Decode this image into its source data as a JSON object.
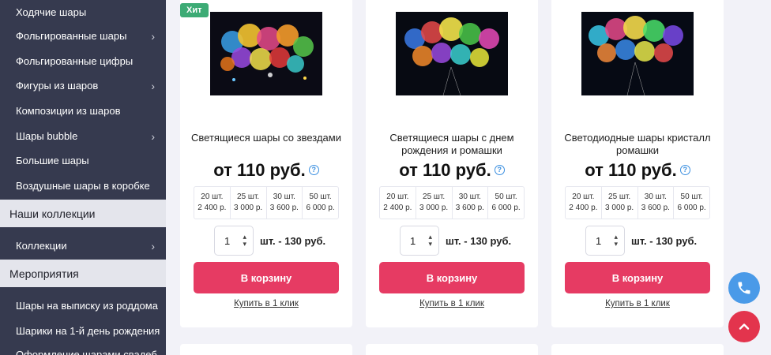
{
  "sidebar": {
    "items": [
      {
        "label": "Ходячие шары",
        "arrow": false
      },
      {
        "label": "Фольгированные шары",
        "arrow": true
      },
      {
        "label": "Фольгированные цифры",
        "arrow": false
      },
      {
        "label": "Фигуры из шаров",
        "arrow": true
      },
      {
        "label": "Композиции из шаров",
        "arrow": false
      },
      {
        "label": "Шары bubble",
        "arrow": true
      },
      {
        "label": "Большие шары",
        "arrow": false
      },
      {
        "label": "Воздушные шары в коробке",
        "arrow": false
      }
    ],
    "section_collections": "Наши коллекции",
    "collections_item": "Коллекции",
    "section_events": "Мероприятия",
    "event_items": [
      "Шары на выписку из роддома",
      "Шарики на 1-й день рождения",
      "Оформление шарами свадеб"
    ],
    "arrow_glyph": "›"
  },
  "products": [
    {
      "badge": "Хит",
      "title": "Светящиеся шары со звездами",
      "price": "от 110 руб.",
      "help": "?",
      "tiers": [
        {
          "qty": "20 шт.",
          "price": "2 400 р."
        },
        {
          "qty": "25 шт.",
          "price": "3 000 р."
        },
        {
          "qty": "30 шт.",
          "price": "3 600 р."
        },
        {
          "qty": "50 шт.",
          "price": "6 000 р."
        }
      ],
      "quantity": "1",
      "unit_price": "шт. - 130 руб.",
      "cart_label": "В корзину",
      "one_click": "Купить в 1 клик",
      "image": "glowing-balloons-stars"
    },
    {
      "badge": "",
      "title": "Светящиеся шары с днем рождения и ромашки",
      "price": "от 110 руб.",
      "help": "?",
      "tiers": [
        {
          "qty": "20 шт.",
          "price": "2 400 р."
        },
        {
          "qty": "25 шт.",
          "price": "3 000 р."
        },
        {
          "qty": "30 шт.",
          "price": "3 600 р."
        },
        {
          "qty": "50 шт.",
          "price": "6 000 р."
        }
      ],
      "quantity": "1",
      "unit_price": "шт. - 130 руб.",
      "cart_label": "В корзину",
      "one_click": "Купить в 1 клик",
      "image": "glowing-balloons-birthday"
    },
    {
      "badge": "",
      "title": "Светодиодные шары кристалл ромашки",
      "price": "от 110 руб.",
      "help": "?",
      "tiers": [
        {
          "qty": "20 шт.",
          "price": "2 400 р."
        },
        {
          "qty": "25 шт.",
          "price": "3 000 р."
        },
        {
          "qty": "30 шт.",
          "price": "3 600 р."
        },
        {
          "qty": "50 шт.",
          "price": "6 000 р."
        }
      ],
      "quantity": "1",
      "unit_price": "шт. - 130 руб.",
      "cart_label": "В корзину",
      "one_click": "Купить в 1 клик",
      "image": "led-crystal-balloons"
    }
  ],
  "icons": {
    "phone": "phone-icon",
    "scroll_up": "chevron-up-icon",
    "stepper_up": "▴",
    "stepper_down": "▾"
  },
  "colors": {
    "sidebar_bg": "#363a4f",
    "cart_button": "#e63b63",
    "badge": "#3dab75",
    "phone_fab": "#4a9ae8",
    "up_fab": "#e3344d"
  }
}
